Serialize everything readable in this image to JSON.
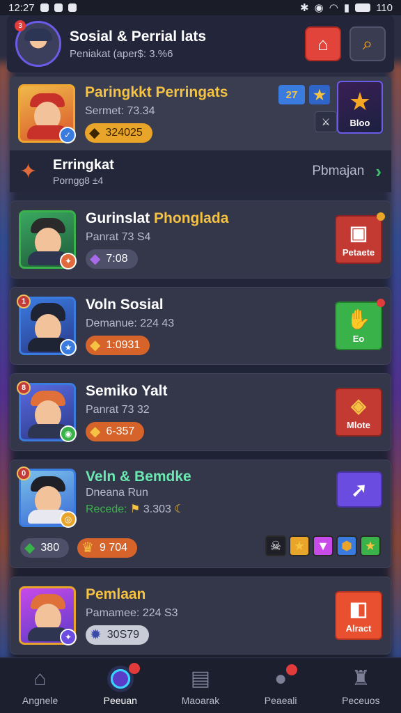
{
  "status_bar": {
    "time": "12:27",
    "battery": "110"
  },
  "header": {
    "title": "Sosial & Perrial lats",
    "subtitle": "Peniakat (aper$: 3.%6",
    "notif_count": "3"
  },
  "featured": {
    "title": "Paringkkt Perringats",
    "subtitle": "Sermet: 73.34",
    "pill_value": "324025",
    "tile_number": "27",
    "big_tile_label": "Bloo",
    "colors": {
      "cap": "#c8302a",
      "body": "#c8302a",
      "border": "#f0a830"
    }
  },
  "section": {
    "title": "Erringkat",
    "subtitle": "Porngg8 ±4",
    "link": "Pbmajan"
  },
  "rows": [
    {
      "title_part1": "Gurinslat ",
      "title_part2": "Phonglada",
      "subtitle": "Panrat 73 S4",
      "pill_value": "7:08",
      "pill_style": "grey",
      "pill_icon": "gem-icon",
      "action_label": "Petaete",
      "action_color": "red",
      "rank": ""
    },
    {
      "title_part1": "Voln Sosial",
      "title_part2": "",
      "subtitle": "Demanue: 224 43",
      "pill_value": "1:0931",
      "pill_style": "orange",
      "pill_icon": "gold-gem-icon",
      "action_label": "Eo",
      "action_color": "green",
      "rank": "1"
    },
    {
      "title_part1": "Semiko Yalt",
      "title_part2": "",
      "subtitle": "Panrat 73 32",
      "pill_value": "6-357",
      "pill_style": "orange",
      "pill_icon": "gold-gem-icon",
      "action_label": "Mlote",
      "action_color": "red",
      "rank": "8"
    },
    {
      "title_part1": "Veln & Bemdke",
      "title_part2": "",
      "subtitle": "Dneana Run",
      "extra_line_label": "Recede:",
      "extra_line_value": "3.303",
      "pill_value": "380",
      "pill_value2": "9 704",
      "action_label": "",
      "action_color": "purple",
      "rank": "0"
    },
    {
      "title_part1": "Pemlaan",
      "title_part2": "",
      "subtitle": "Pamamee: 224 S3",
      "pill_value": "30S79",
      "pill_style": "light",
      "pill_icon": "star-badge-icon",
      "action_label": "Alract",
      "action_color": "orange",
      "rank": ""
    }
  ],
  "nav": [
    {
      "label": "Angnele",
      "icon": "home-icon"
    },
    {
      "label": "Peeuan",
      "icon": "orb-icon",
      "active": true
    },
    {
      "label": "Maoarak",
      "icon": "calendar-icon"
    },
    {
      "label": "Peaeali",
      "icon": "people-icon"
    },
    {
      "label": "Peceuos",
      "icon": "trophy-icon"
    }
  ]
}
